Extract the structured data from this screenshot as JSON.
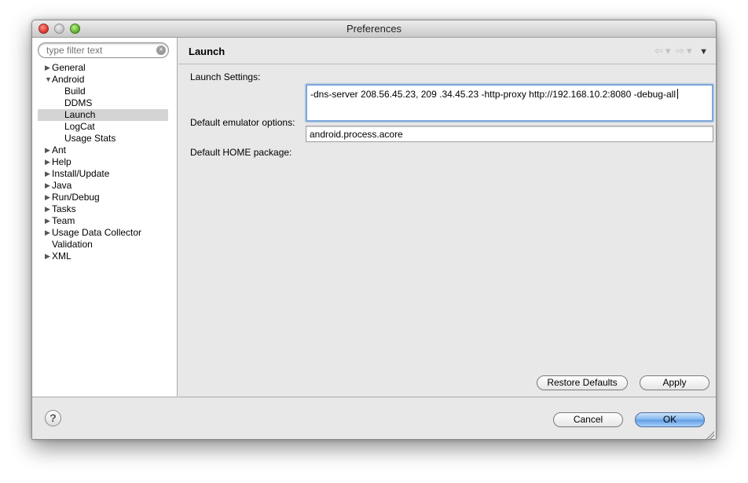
{
  "window": {
    "title": "Preferences"
  },
  "sidebar": {
    "search_placeholder": "type filter text",
    "items": [
      {
        "label": "General",
        "arrow": "▶"
      },
      {
        "label": "Android",
        "arrow": "▼"
      },
      {
        "label": "Build"
      },
      {
        "label": "DDMS"
      },
      {
        "label": "Launch"
      },
      {
        "label": "LogCat"
      },
      {
        "label": "Usage Stats"
      },
      {
        "label": "Ant",
        "arrow": "▶"
      },
      {
        "label": "Help",
        "arrow": "▶"
      },
      {
        "label": "Install/Update",
        "arrow": "▶"
      },
      {
        "label": "Java",
        "arrow": "▶"
      },
      {
        "label": "Run/Debug",
        "arrow": "▶"
      },
      {
        "label": "Tasks",
        "arrow": "▶"
      },
      {
        "label": "Team",
        "arrow": "▶"
      },
      {
        "label": "Usage Data Collector",
        "arrow": "▶"
      },
      {
        "label": "Validation"
      },
      {
        "label": "XML",
        "arrow": "▶"
      }
    ]
  },
  "page": {
    "title": "Launch",
    "nav": {
      "back": "⇦",
      "forward": "⇨",
      "dropdown": "▾",
      "menu": "▼"
    },
    "section_label": "Launch Settings:",
    "emulator_options_label": "Default emulator options:",
    "emulator_options_value": "-dns-server 208.56.45.23, 209 .34.45.23 -http-proxy http://192.168.10.2:8080 -debug-all",
    "home_package_label": "Default HOME package:",
    "home_package_value": "android.process.acore",
    "restore_defaults_label": "Restore Defaults",
    "apply_label": "Apply"
  },
  "footer": {
    "help_icon": "?",
    "cancel_label": "Cancel",
    "ok_label": "OK"
  }
}
